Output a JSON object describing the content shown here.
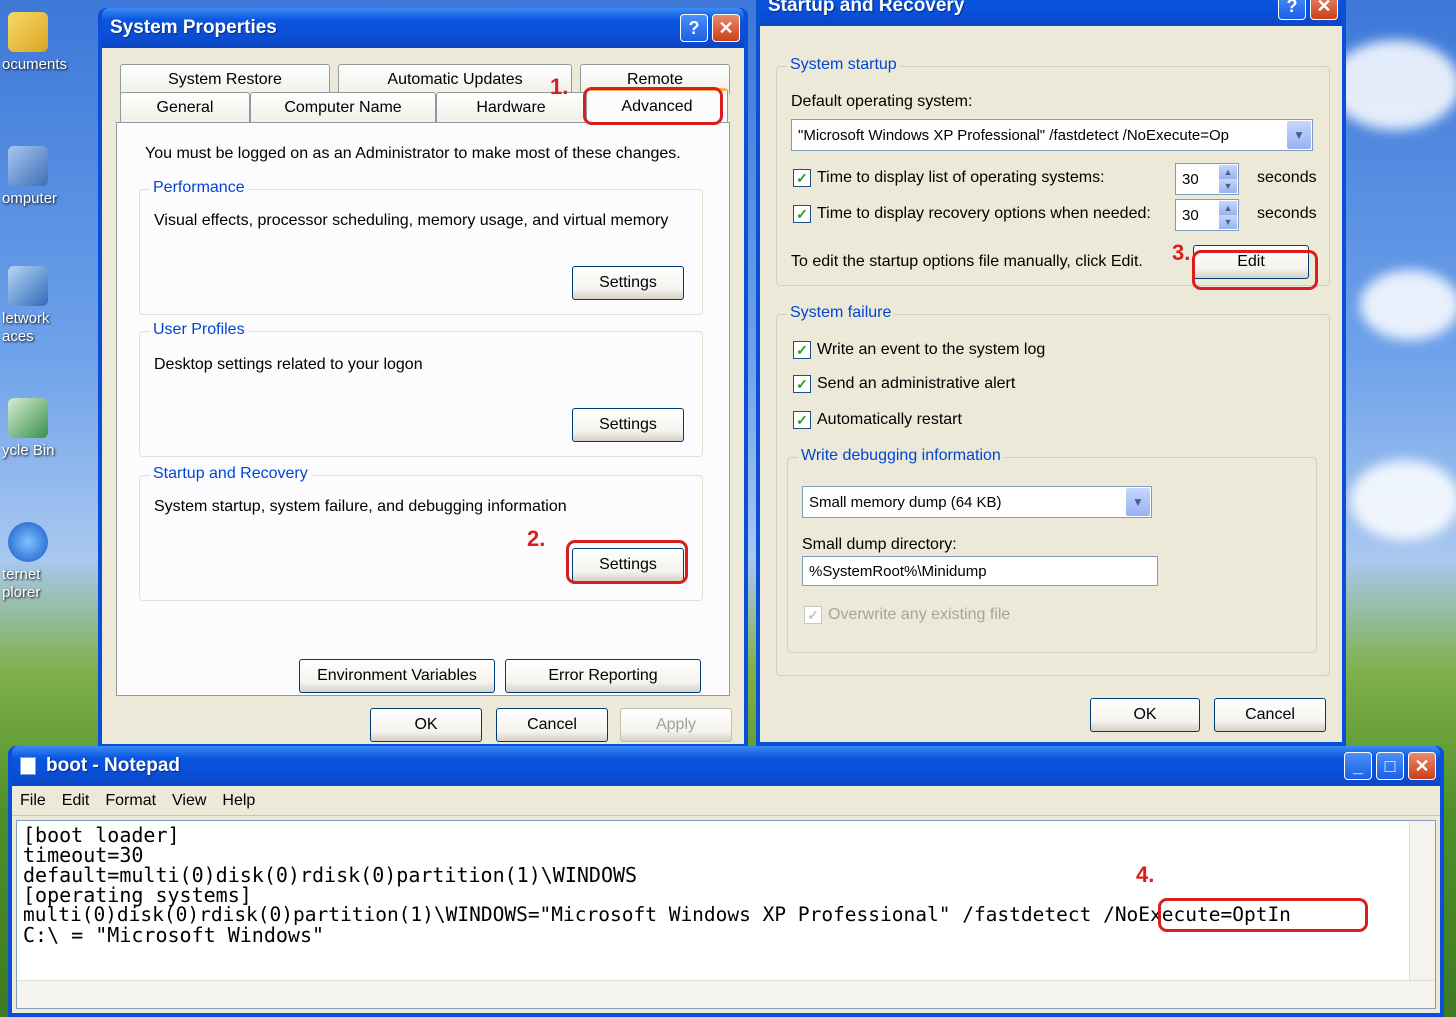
{
  "desktop": {
    "icons": [
      {
        "label": "ocuments",
        "icon": "documents-folder-icon"
      },
      {
        "label": "omputer",
        "icon": "computer-icon"
      },
      {
        "label": "letwork\naces",
        "icon": "network-places-icon"
      },
      {
        "label": "ycle Bin",
        "icon": "recycle-bin-icon"
      },
      {
        "label": "ternet\nplorer",
        "icon": "internet-explorer-icon"
      }
    ]
  },
  "system_properties": {
    "title": "System Properties",
    "tabs_row1": [
      "System Restore",
      "Automatic Updates",
      "Remote"
    ],
    "tabs_row2": [
      "General",
      "Computer Name",
      "Hardware",
      "Advanced"
    ],
    "active_tab": "Advanced",
    "admin_note": "You must be logged on as an Administrator to make most of these changes.",
    "performance": {
      "legend": "Performance",
      "desc": "Visual effects, processor scheduling, memory usage, and virtual memory",
      "button": "Settings"
    },
    "user_profiles": {
      "legend": "User Profiles",
      "desc": "Desktop settings related to your logon",
      "button": "Settings"
    },
    "startup_recovery": {
      "legend": "Startup and Recovery",
      "desc": "System startup, system failure, and debugging information",
      "button": "Settings"
    },
    "env_button": "Environment Variables",
    "error_button": "Error Reporting",
    "ok": "OK",
    "cancel": "Cancel",
    "apply": "Apply"
  },
  "startup_recovery_dialog": {
    "title": "Startup and Recovery",
    "system_startup": {
      "legend": "System startup",
      "default_os_label": "Default operating system:",
      "default_os_value": "\"Microsoft Windows XP Professional\" /fastdetect /NoExecute=Op",
      "list_label": "Time to display list of operating systems:",
      "list_value": "30",
      "list_unit": "seconds",
      "recovery_label": "Time to display recovery options when needed:",
      "recovery_value": "30",
      "recovery_unit": "seconds",
      "edit_note": "To edit the startup options file manually, click Edit.",
      "edit_button": "Edit"
    },
    "system_failure": {
      "legend": "System failure",
      "write_event": "Write an event to the system log",
      "send_alert": "Send an administrative alert",
      "auto_restart": "Automatically restart",
      "debug_legend": "Write debugging information",
      "dump_type": "Small memory dump (64 KB)",
      "dump_dir_label": "Small dump directory:",
      "dump_dir_value": "%SystemRoot%\\Minidump",
      "overwrite": "Overwrite any existing file"
    },
    "ok": "OK",
    "cancel": "Cancel"
  },
  "notepad": {
    "title": "boot - Notepad",
    "menu": [
      "File",
      "Edit",
      "Format",
      "View",
      "Help"
    ],
    "lines": [
      "[boot loader]",
      "timeout=30",
      "default=multi(0)disk(0)rdisk(0)partition(1)\\WINDOWS",
      "[operating systems]",
      "multi(0)disk(0)rdisk(0)partition(1)\\WINDOWS=\"Microsoft Windows XP Professional\" /fastdetect /NoExecute=OptIn",
      "C:\\ = \"Microsoft Windows\""
    ]
  },
  "annotations": {
    "step1": "1.",
    "step2": "2.",
    "step3": "3.",
    "step4": "4."
  },
  "colors": {
    "xp_blue": "#0a56e0",
    "annotation_red": "#d81e1e",
    "dialog_bg": "#ece9d8"
  }
}
